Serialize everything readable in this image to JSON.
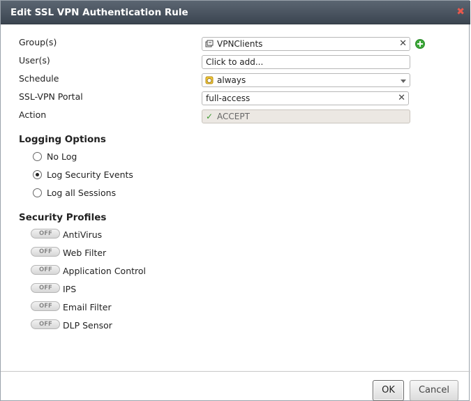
{
  "dialog": {
    "title": "Edit SSL VPN Authentication Rule"
  },
  "form": {
    "groups_label": "Group(s)",
    "groups_value": "VPNClients",
    "users_label": "User(s)",
    "users_placeholder": "Click to add...",
    "schedule_label": "Schedule",
    "schedule_value": "always",
    "portal_label": "SSL-VPN Portal",
    "portal_value": "full-access",
    "action_label": "Action",
    "action_value": "ACCEPT"
  },
  "logging": {
    "title": "Logging Options",
    "options": [
      "No Log",
      "Log Security Events",
      "Log all Sessions"
    ],
    "selected": "Log Security Events"
  },
  "security": {
    "title": "Security Profiles",
    "toggle_text": "OFF",
    "profiles": [
      "AntiVirus",
      "Web Filter",
      "Application Control",
      "IPS",
      "Email Filter",
      "DLP Sensor"
    ]
  },
  "footer": {
    "ok_label": "OK",
    "cancel_label": "Cancel"
  },
  "colors": {
    "titlebar": "#4a5560",
    "add_icon": "#3da83a",
    "close_icon": "#e8594d"
  }
}
